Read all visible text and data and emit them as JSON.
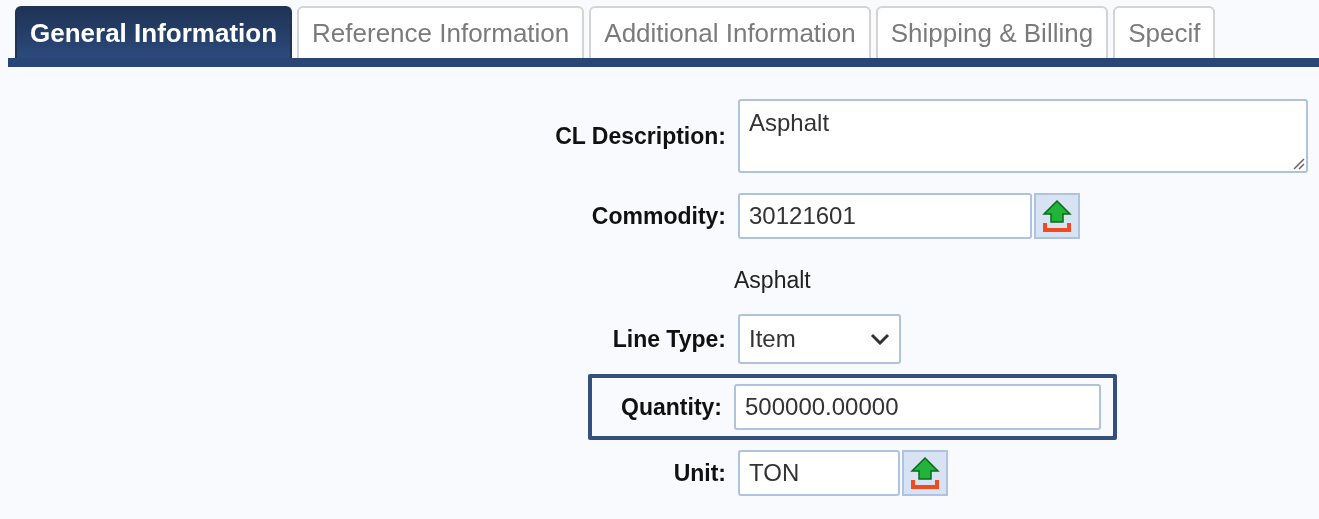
{
  "tabs": [
    {
      "label": "General Information",
      "selected": true
    },
    {
      "label": "Reference Information",
      "selected": false
    },
    {
      "label": "Additional Information",
      "selected": false
    },
    {
      "label": "Shipping & Billing",
      "selected": false
    },
    {
      "label": "Specif",
      "selected": false
    }
  ],
  "fields": [
    {
      "kind": "textarea",
      "label": "CL Description:",
      "value": "Asphalt",
      "highlighted": false
    },
    {
      "kind": "lookup",
      "label": "Commodity:",
      "value": "30121601",
      "highlighted": false
    },
    {
      "kind": "text",
      "value": "Asphalt",
      "highlighted": false
    },
    {
      "kind": "select",
      "label": "Line Type:",
      "value": "Item",
      "highlighted": false
    },
    {
      "kind": "input",
      "label": "Quantity:",
      "value": "500000.00000",
      "highlighted": true
    },
    {
      "kind": "lookup-short",
      "label": "Unit:",
      "value": "TON",
      "highlighted": false
    }
  ]
}
